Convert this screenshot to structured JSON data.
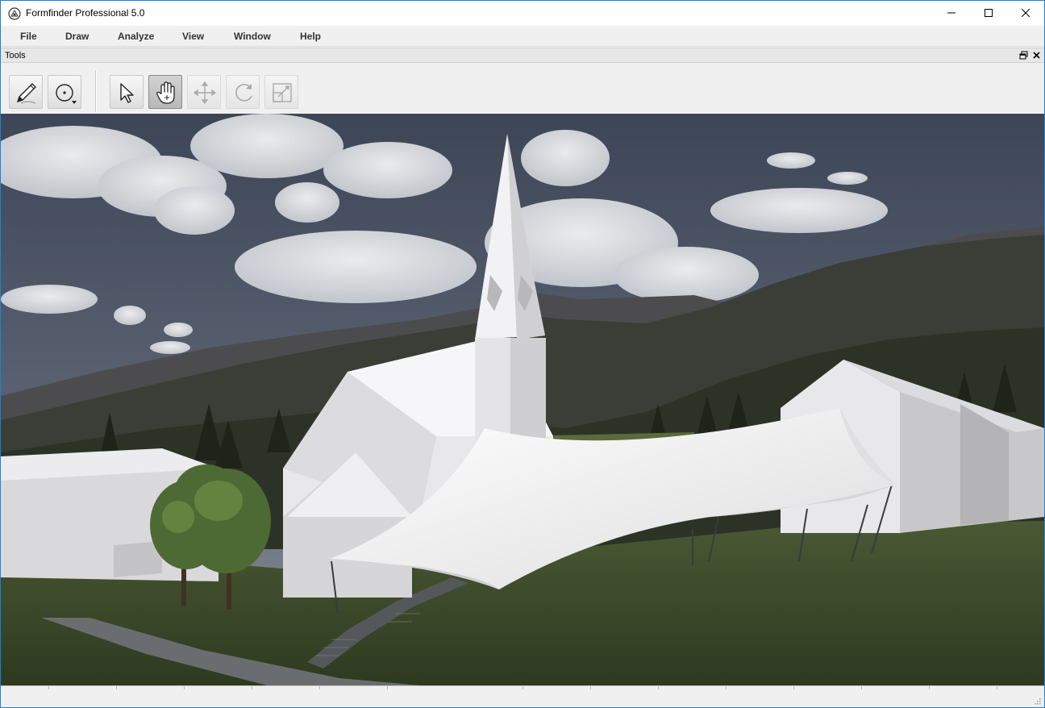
{
  "window": {
    "title": "Formfinder Professional 5.0",
    "icon": "formfinder-logo-icon",
    "controls": [
      "minimize-icon",
      "maximize-icon",
      "close-icon"
    ]
  },
  "menu": {
    "items": [
      {
        "label": "File"
      },
      {
        "label": "Draw"
      },
      {
        "label": "Analyze"
      },
      {
        "label": "View"
      },
      {
        "label": "Window"
      },
      {
        "label": "Help"
      }
    ]
  },
  "tools_panel": {
    "title": "Tools",
    "buttons": [
      {
        "icon": "pencil-draw-icon",
        "state": "normal"
      },
      {
        "icon": "circle-point-icon",
        "state": "normal"
      },
      {
        "icon": "pointer-arrow-icon",
        "state": "normal"
      },
      {
        "icon": "hand-pan-icon",
        "state": "active"
      },
      {
        "icon": "move-arrows-icon",
        "state": "disabled"
      },
      {
        "icon": "rotate-icon",
        "state": "disabled"
      },
      {
        "icon": "scale-icon",
        "state": "disabled"
      }
    ]
  },
  "viewport": {
    "content": "3d-render-scene"
  },
  "colors": {
    "window_border": "#1883d7",
    "chrome": "#f0f0f0",
    "sky": "#4a5260",
    "grass": "#3c4a2c",
    "membrane": "#f2f2f2"
  }
}
